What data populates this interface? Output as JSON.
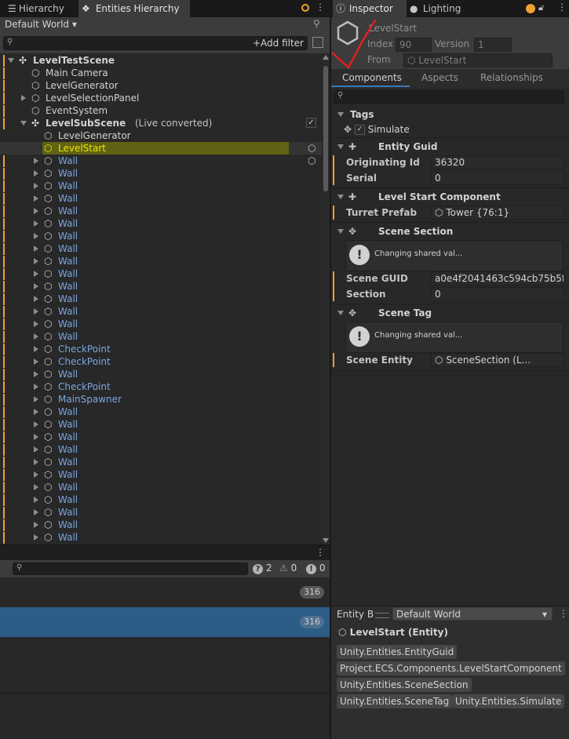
{
  "left_tabs": [
    "Hierarchy",
    "Entities Hierarchy"
  ],
  "world_dropdown": "Default World",
  "add_filter": "Add filter",
  "tree": [
    {
      "label": "LevelTestScene",
      "bold": true,
      "blue": false,
      "arrow": "down",
      "indent": 0,
      "icon": "unity",
      "bar": true
    },
    {
      "label": "Main Camera",
      "indent": 1,
      "icon": "cube",
      "bar": true
    },
    {
      "label": "LevelGenerator",
      "indent": 1,
      "icon": "cube",
      "bar": true
    },
    {
      "label": "LevelSelectionPanel",
      "indent": 1,
      "icon": "cube",
      "arrow": "right",
      "bar": true
    },
    {
      "label": "EventSystem",
      "indent": 1,
      "icon": "cube",
      "bar": true
    },
    {
      "label": "LevelSubScene",
      "suffix": "(Live converted)",
      "bold": true,
      "indent": 1,
      "icon": "unity",
      "arrow": "down",
      "bar": true,
      "check": true
    },
    {
      "label": "LevelGenerator",
      "indent": 2,
      "icon": "cube"
    },
    {
      "label": "LevelStart",
      "indent": 2,
      "icon": "cube-yellow",
      "selected": true,
      "yellow": true,
      "righticon": true
    },
    {
      "label": "Wall",
      "indent": 2,
      "icon": "hex",
      "arrow": "right",
      "blue": true,
      "bar": true,
      "righticon": true
    },
    {
      "label": "Wall",
      "indent": 2,
      "icon": "hex",
      "arrow": "right",
      "blue": true,
      "bar": true
    },
    {
      "label": "Wall",
      "indent": 2,
      "icon": "hex",
      "arrow": "right",
      "blue": true,
      "bar": true
    },
    {
      "label": "Wall",
      "indent": 2,
      "icon": "hex",
      "arrow": "right",
      "blue": true,
      "bar": true
    },
    {
      "label": "Wall",
      "indent": 2,
      "icon": "hex",
      "arrow": "right",
      "blue": true,
      "bar": true
    },
    {
      "label": "Wall",
      "indent": 2,
      "icon": "hex",
      "arrow": "right",
      "blue": true,
      "bar": true
    },
    {
      "label": "Wall",
      "indent": 2,
      "icon": "hex",
      "arrow": "right",
      "blue": true,
      "bar": true
    },
    {
      "label": "Wall",
      "indent": 2,
      "icon": "hex",
      "arrow": "right",
      "blue": true,
      "bar": true
    },
    {
      "label": "Wall",
      "indent": 2,
      "icon": "hex",
      "arrow": "right",
      "blue": true,
      "bar": true
    },
    {
      "label": "Wall",
      "indent": 2,
      "icon": "hex",
      "arrow": "right",
      "blue": true,
      "bar": true
    },
    {
      "label": "Wall",
      "indent": 2,
      "icon": "hex",
      "arrow": "right",
      "blue": true,
      "bar": true
    },
    {
      "label": "Wall",
      "indent": 2,
      "icon": "hex",
      "arrow": "right",
      "blue": true,
      "bar": true
    },
    {
      "label": "Wall",
      "indent": 2,
      "icon": "hex",
      "arrow": "right",
      "blue": true,
      "bar": true
    },
    {
      "label": "Wall",
      "indent": 2,
      "icon": "hex",
      "arrow": "right",
      "blue": true,
      "bar": true
    },
    {
      "label": "Wall",
      "indent": 2,
      "icon": "hex",
      "arrow": "right",
      "blue": true,
      "bar": true
    },
    {
      "label": "CheckPoint",
      "indent": 2,
      "icon": "hex",
      "arrow": "right",
      "blue": true,
      "bar": true
    },
    {
      "label": "CheckPoint",
      "indent": 2,
      "icon": "hex",
      "arrow": "right",
      "blue": true,
      "bar": true
    },
    {
      "label": "Wall",
      "indent": 2,
      "icon": "hex",
      "arrow": "right",
      "blue": true,
      "bar": true
    },
    {
      "label": "CheckPoint",
      "indent": 2,
      "icon": "hex",
      "arrow": "right",
      "blue": true,
      "bar": true
    },
    {
      "label": "MainSpawner",
      "indent": 2,
      "icon": "hex",
      "arrow": "right",
      "blue": true,
      "bar": true
    },
    {
      "label": "Wall",
      "indent": 2,
      "icon": "hex",
      "arrow": "right",
      "blue": true,
      "bar": true
    },
    {
      "label": "Wall",
      "indent": 2,
      "icon": "hex",
      "arrow": "right",
      "blue": true,
      "bar": true
    },
    {
      "label": "Wall",
      "indent": 2,
      "icon": "hex",
      "arrow": "right",
      "blue": true,
      "bar": true
    },
    {
      "label": "Wall",
      "indent": 2,
      "icon": "hex",
      "arrow": "right",
      "blue": true,
      "bar": true
    },
    {
      "label": "Wall",
      "indent": 2,
      "icon": "hex",
      "arrow": "right",
      "blue": true,
      "bar": true
    },
    {
      "label": "Wall",
      "indent": 2,
      "icon": "hex",
      "arrow": "right",
      "blue": true,
      "bar": true
    },
    {
      "label": "Wall",
      "indent": 2,
      "icon": "hex",
      "arrow": "right",
      "blue": true,
      "bar": true
    },
    {
      "label": "Wall",
      "indent": 2,
      "icon": "hex",
      "arrow": "right",
      "blue": true,
      "bar": true
    },
    {
      "label": "Wall",
      "indent": 2,
      "icon": "hex",
      "arrow": "right",
      "blue": true,
      "bar": true
    },
    {
      "label": "Wall",
      "indent": 2,
      "icon": "hex",
      "arrow": "right",
      "blue": true,
      "bar": true
    },
    {
      "label": "Wall",
      "indent": 2,
      "icon": "hex",
      "arrow": "right",
      "blue": true,
      "bar": true
    }
  ],
  "console": {
    "counts": {
      "messages": "2",
      "warnings": "0",
      "errors": "0"
    },
    "row_badges": [
      "316",
      "316"
    ]
  },
  "right_tabs": [
    "Inspector",
    "Lighting"
  ],
  "entity_header": {
    "name": "LevelStart",
    "index_label": "Index",
    "index_value": "90",
    "version_label": "Version",
    "version_value": "1",
    "from_label": "From",
    "from_value": "LevelStart"
  },
  "inspector_tabs": [
    "Components",
    "Aspects",
    "Relationships"
  ],
  "tags": {
    "title": "Tags",
    "simulate": "Simulate"
  },
  "components": {
    "entity_guid": {
      "title": "Entity Guid",
      "originating_id_label": "Originating Id",
      "originating_id": "36320",
      "serial_label": "Serial",
      "serial": "0"
    },
    "level_start": {
      "title": "Level Start Component",
      "turret_prefab_label": "Turret Prefab",
      "turret_prefab": "Tower {76:1}"
    },
    "scene_section": {
      "title": "Scene Section",
      "help": "Changing shared val...",
      "scene_guid_label": "Scene GUID",
      "scene_guid": "a0e4f2041463c594cb75b5f",
      "section_label": "Section",
      "section": "0"
    },
    "scene_tag": {
      "title": "Scene Tag",
      "help": "Changing shared val...",
      "scene_entity_label": "Scene Entity",
      "scene_entity": "SceneSection (L..."
    }
  },
  "entity_baking": {
    "title": "Entity B",
    "world": "Default World",
    "entity_name": "LevelStart (Entity)",
    "chips": [
      "Unity.Entities.EntityGuid",
      "Project.ECS.Components.LevelStartComponent",
      "Unity.Entities.SceneSection",
      "Unity.Entities.SceneTag",
      "Unity.Entities.Simulate"
    ]
  },
  "colors": {
    "accent": "#f0a030",
    "selection": "#2c5d87",
    "link": "#7ba6e0",
    "highlight": "#6b6b10",
    "annotation": "#e02020"
  }
}
